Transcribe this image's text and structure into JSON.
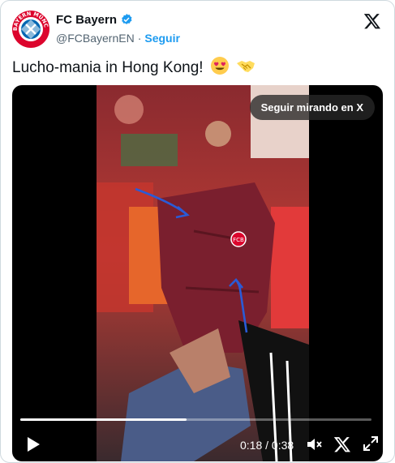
{
  "account": {
    "display_name": "FC Bayern",
    "handle": "@FCBayernEN",
    "separator": "·",
    "follow_label": "Seguir",
    "avatar_icon": "fc-bayern-crest",
    "avatar_text": "FC BAYERN MÜNCHEN",
    "verified_icon": "verified-badge-icon"
  },
  "tweet": {
    "text": "Lucho-mania in Hong Kong!",
    "emojis": [
      "heart-eyes-emoji",
      "handshake-emoji"
    ]
  },
  "video": {
    "overlay_label": "Seguir mirando en X",
    "current_time": "0:18",
    "duration": "0:38",
    "time_separator": " / ",
    "progress_fraction": 0.4737,
    "controls": [
      "play-icon",
      "volume-icon",
      "x-logo-icon",
      "fullscreen-icon"
    ],
    "shirt_crest_text": "FCB"
  },
  "colors": {
    "brand_red": "#dc052d",
    "verified_blue": "#1d9bf0",
    "follow_blue": "#1d9bf0",
    "shirt_maroon": "#7a1f2e",
    "video_bg": "#000000"
  }
}
